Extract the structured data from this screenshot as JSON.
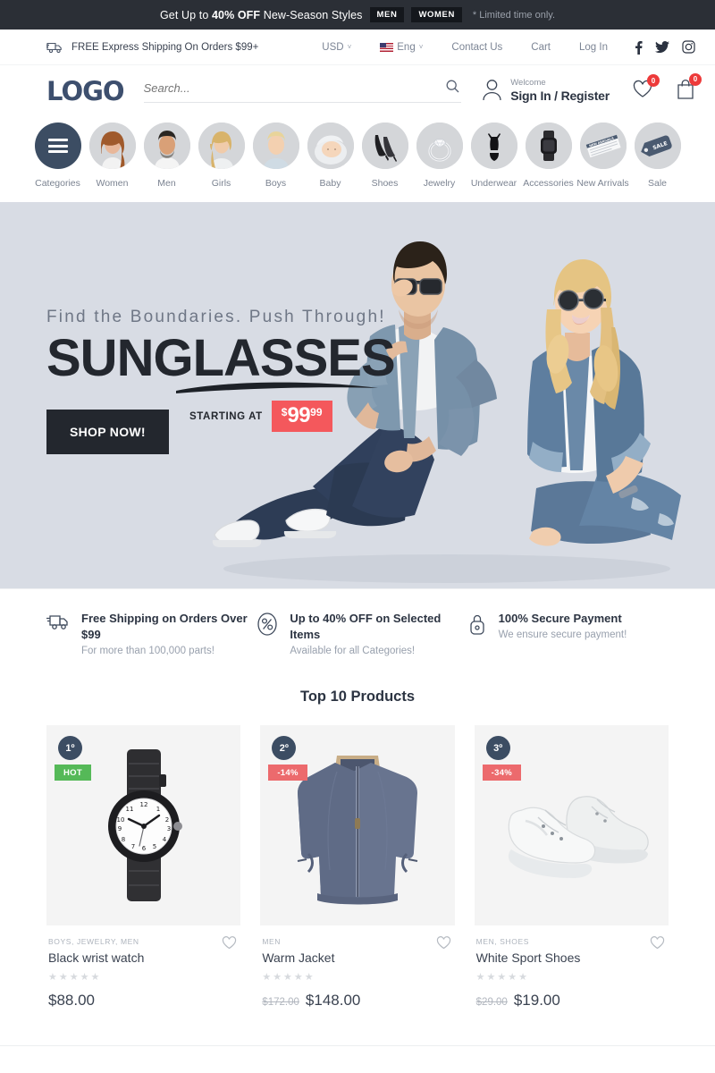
{
  "promo": {
    "text_before": "Get Up to ",
    "highlight": "40% OFF",
    "text_after": " New-Season Styles",
    "chip_men": "MEN",
    "chip_women": "WOMEN",
    "note": "* Limited time only."
  },
  "utility": {
    "shipping": "FREE Express Shipping On Orders $99+",
    "currency": "USD",
    "language": "Eng",
    "contact": "Contact Us",
    "cart": "Cart",
    "login": "Log In",
    "caret": "˅",
    "social": [
      "facebook-icon",
      "twitter-icon",
      "instagram-icon"
    ]
  },
  "header": {
    "logo": "LOGO",
    "search_placeholder": "Search...",
    "welcome": "Welcome",
    "signin": "Sign In / Register",
    "wishlist_count": "0",
    "cart_count": "0"
  },
  "categories": [
    {
      "label": "Categories",
      "icon": "hamburger-icon"
    },
    {
      "label": "Women",
      "icon": "woman-portrait"
    },
    {
      "label": "Men",
      "icon": "man-portrait"
    },
    {
      "label": "Girls",
      "icon": "girl-portrait"
    },
    {
      "label": "Boys",
      "icon": "boy-portrait"
    },
    {
      "label": "Baby",
      "icon": "baby-portrait"
    },
    {
      "label": "Shoes",
      "icon": "heels-icon"
    },
    {
      "label": "Jewelry",
      "icon": "ring-icon"
    },
    {
      "label": "Underwear",
      "icon": "lingerie-icon"
    },
    {
      "label": "Accessories",
      "icon": "smartwatch-icon"
    },
    {
      "label": "New Arrivals",
      "icon": "new-arrivals-tag-icon"
    },
    {
      "label": "Sale",
      "icon": "sale-tag-icon"
    }
  ],
  "hero": {
    "subtitle": "Find the Boundaries. Push Through!",
    "title": "SUNGLASSES",
    "button": "SHOP NOW!",
    "starting_label": "STARTING AT",
    "price_currency": "$",
    "price_main": "99",
    "price_decimals": "99",
    "background_color": "#d8dce4",
    "tag_color": "#f4585c"
  },
  "features": [
    {
      "icon": "truck-icon",
      "title": "Free Shipping on Orders Over $99",
      "desc": "For more than 100,000 parts!"
    },
    {
      "icon": "percent-icon",
      "title": "Up to 40% OFF on Selected Items",
      "desc": "Available for all Categories!"
    },
    {
      "icon": "lock-icon",
      "title": "100% Secure Payment",
      "desc": "We ensure secure payment!"
    }
  ],
  "products": {
    "heading": "Top 10 Products",
    "items": [
      {
        "rank": "1º",
        "badge": "HOT",
        "badge_type": "hot",
        "categories": "BOYS, JEWELRY, MEN",
        "name": "Black wrist watch",
        "stars": "★★★★★",
        "price_old": "",
        "price_new": "$88.00",
        "image": "black-wrist-watch"
      },
      {
        "rank": "2º",
        "badge": "-14%",
        "badge_type": "off",
        "categories": "MEN",
        "name": "Warm Jacket",
        "stars": "★★★★★",
        "price_old": "$172.00",
        "price_new": "$148.00",
        "image": "warm-jacket"
      },
      {
        "rank": "3º",
        "badge": "-34%",
        "badge_type": "off",
        "categories": "MEN, SHOES",
        "name": "White Sport Shoes",
        "stars": "★★★★★",
        "price_old": "$29.00",
        "price_new": "$19.00",
        "image": "white-sport-shoes"
      }
    ]
  }
}
